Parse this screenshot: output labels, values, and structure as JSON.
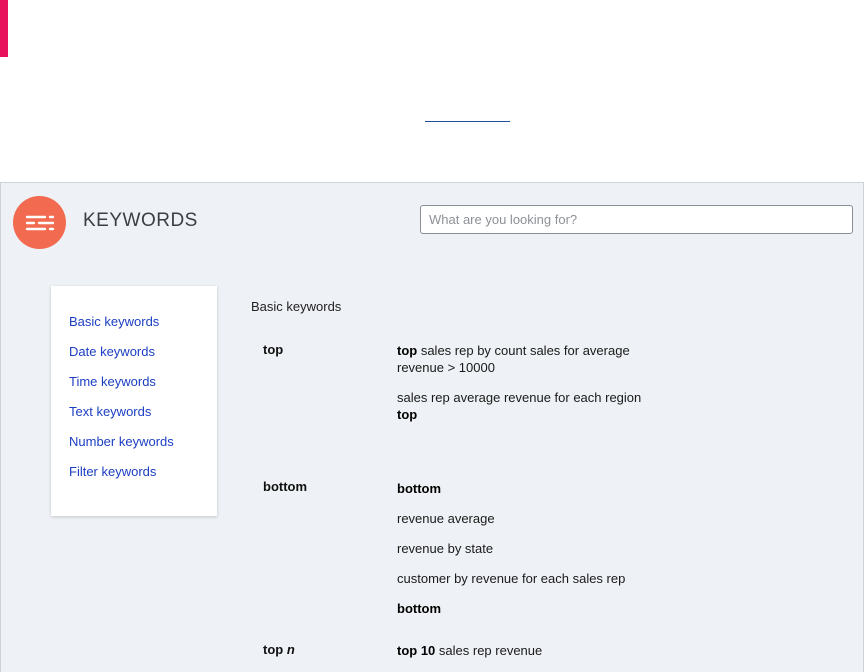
{
  "app": {
    "title": "KEYWORDS",
    "logo_icon": "stacked-bars-logo-icon",
    "accent_color": "#e8125c",
    "logo_color": "#f26a4f",
    "link_color": "#1b3ec2"
  },
  "search": {
    "placeholder": "What are you looking for?",
    "value": ""
  },
  "sidebar": {
    "items": [
      {
        "label": "Basic keywords"
      },
      {
        "label": "Date keywords"
      },
      {
        "label": "Time keywords"
      },
      {
        "label": "Text keywords"
      },
      {
        "label": "Number keywords"
      },
      {
        "label": "Filter keywords"
      }
    ]
  },
  "content": {
    "section_title": "Basic keywords",
    "keywords": [
      {
        "name": "top",
        "examples": [
          {
            "bold_prefix": "top",
            "text": " sales rep by count sales for average revenue > 10000"
          },
          {
            "text": "sales rep average revenue for each region ",
            "bold_suffix": "top"
          }
        ]
      },
      {
        "name": "bottom",
        "examples": [
          {
            "bold": "bottom"
          },
          {
            "text": "revenue average"
          },
          {
            "text": "revenue by state"
          },
          {
            "text": "customer by revenue for each sales rep"
          },
          {
            "bold": "bottom"
          }
        ]
      },
      {
        "name": "top",
        "name_suffix": "n",
        "examples": [
          {
            "bold_prefix": "top 10",
            "text": " sales rep revenue"
          }
        ]
      }
    ]
  }
}
